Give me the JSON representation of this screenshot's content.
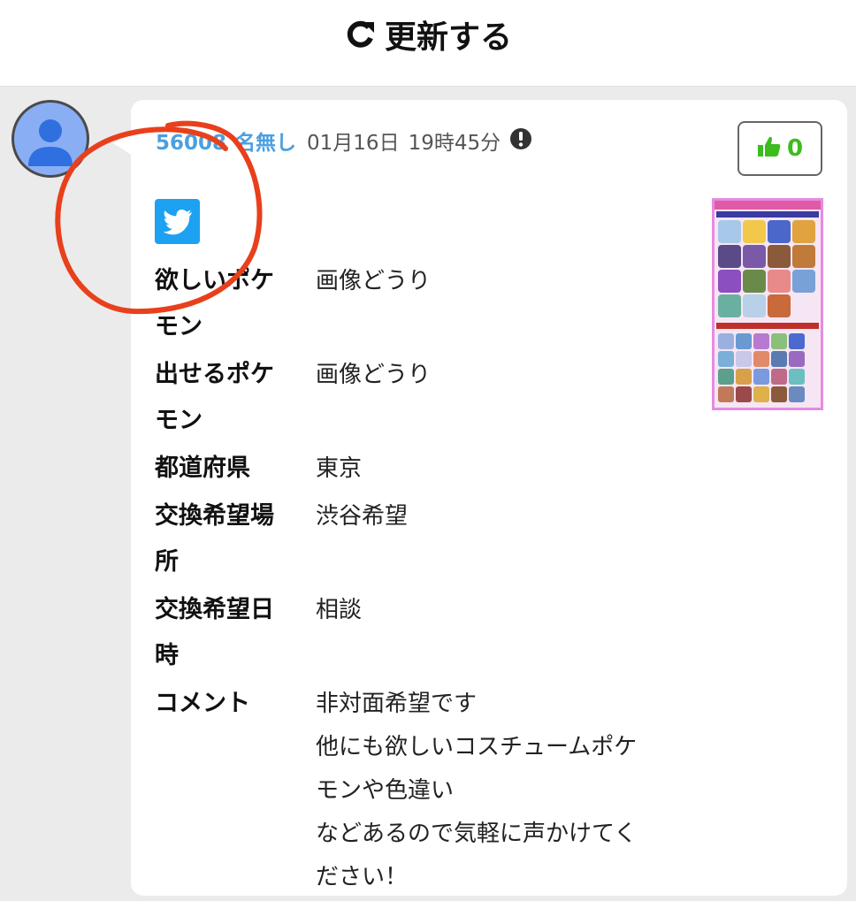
{
  "header": {
    "refresh_label": "更新する",
    "refresh_icon": "refresh-icon"
  },
  "post": {
    "id": "56008",
    "author": "名無し",
    "date": "01月16日",
    "time": "19時45分",
    "like_count": "0",
    "fields": [
      {
        "label": "欲しいポケモン",
        "value": "画像どうり"
      },
      {
        "label": "出せるポケモン",
        "value": "画像どうり"
      },
      {
        "label": "都道府県",
        "value": "東京"
      },
      {
        "label": "交換希望場所",
        "value": "渋谷希望"
      },
      {
        "label": "交換希望日時",
        "value": "相談"
      }
    ],
    "comment_label": "コメント",
    "comment_lines": [
      "非対面希望です",
      "他にも欲しいコスチュームポケ",
      "モンや色違い",
      "などあるので気軽に声かけてく",
      "ださい！"
    ]
  },
  "colors": {
    "accent": "#4aa0e0",
    "like": "#3cbc1d",
    "twitter": "#1da1f2",
    "annotation": "#e8401c"
  }
}
